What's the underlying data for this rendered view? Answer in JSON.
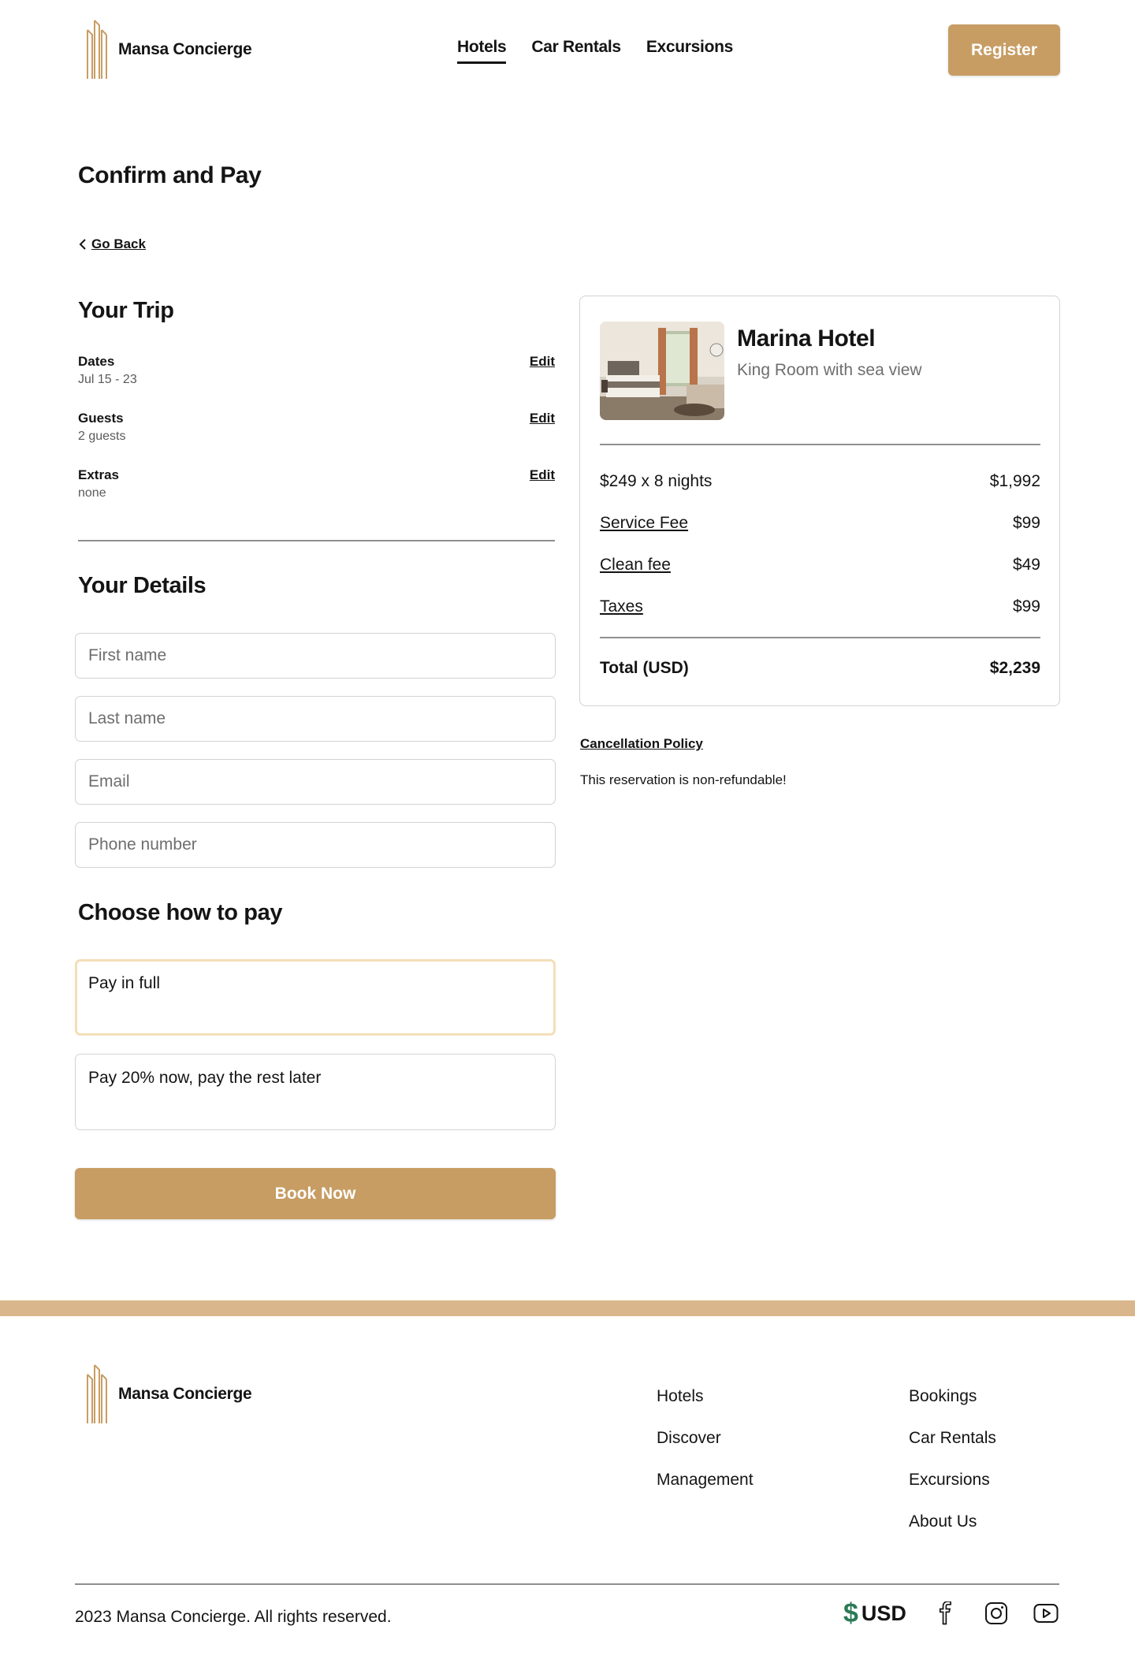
{
  "brand": {
    "name": "Mansa Concierge"
  },
  "nav": {
    "items": [
      {
        "label": "Hotels",
        "active": true
      },
      {
        "label": "Car Rentals",
        "active": false
      },
      {
        "label": "Excursions",
        "active": false
      }
    ]
  },
  "header": {
    "register_label": "Register"
  },
  "page": {
    "title": "Confirm and Pay",
    "go_back": "Go Back"
  },
  "trip": {
    "title": "Your Trip",
    "edit_label": "Edit",
    "rows": [
      {
        "label": "Dates",
        "value": "Jul 15 - 23"
      },
      {
        "label": "Guests",
        "value": "2 guests"
      },
      {
        "label": "Extras",
        "value": "none"
      }
    ]
  },
  "details": {
    "title": "Your Details",
    "fields": [
      {
        "placeholder": "First name",
        "value": ""
      },
      {
        "placeholder": "Last name",
        "value": ""
      },
      {
        "placeholder": "Email",
        "value": ""
      },
      {
        "placeholder": "Phone number",
        "value": ""
      }
    ]
  },
  "payment": {
    "title": "Choose how to pay",
    "options": [
      {
        "label": "Pay in full",
        "selected": true
      },
      {
        "label": "Pay 20% now, pay the rest later",
        "selected": false
      }
    ],
    "book_label": "Book Now"
  },
  "summary": {
    "hotel_name": "Marina Hotel",
    "room": "King Room with sea view",
    "lines": [
      {
        "label": "$249 x 8 nights",
        "amount": "$1,992"
      },
      {
        "label": "Service Fee",
        "amount": "$99"
      },
      {
        "label": "Clean fee",
        "amount": "$49"
      },
      {
        "label": "Taxes",
        "amount": "$99"
      }
    ],
    "total_label": "Total (USD)",
    "total_amount": "$2,239"
  },
  "cancellation": {
    "title": "Cancellation Policy",
    "text": "This reservation is non-refundable!"
  },
  "footer": {
    "col1": [
      "Hotels",
      "Discover",
      "Management"
    ],
    "col2": [
      "Bookings",
      "Car Rentals",
      "Excursions",
      "About Us"
    ],
    "copyright": "2023 Mansa Concierge. All rights reserved.",
    "currency_symbol": "$",
    "currency_code": "USD",
    "social_icons": [
      "facebook-icon",
      "instagram-icon",
      "youtube-icon"
    ]
  },
  "colors": {
    "accent": "#c79d64",
    "band": "#d9b68b",
    "currency_green": "#2a7a56",
    "selected_border": "#f3dfb8"
  }
}
